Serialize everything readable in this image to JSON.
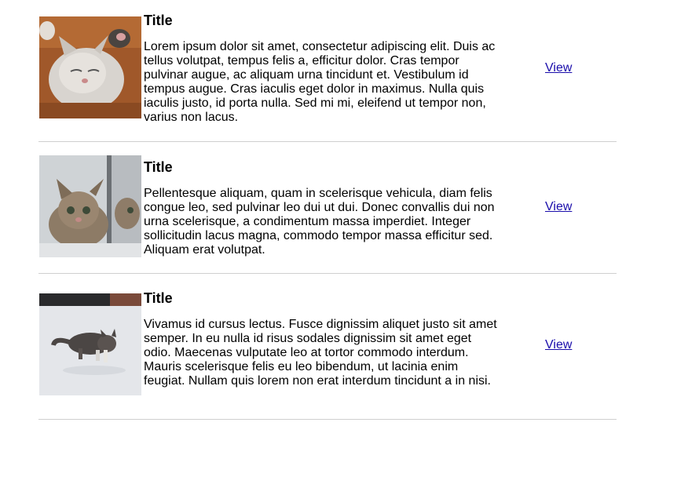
{
  "items": [
    {
      "title": "Title",
      "body": "Lorem ipsum dolor sit amet, consectetur adipiscing elit. Duis ac tellus volutpat, tempus felis a, efficitur dolor. Cras tempor pulvinar augue, ac aliquam urna tincidunt et. Vestibulum id tempus augue. Cras iaculis eget dolor in maximus. Nulla quis iaculis justo, id porta nulla. Sed mi mi, eleifend ut tempor non, varius non lacus.",
      "link": "View"
    },
    {
      "title": "Title",
      "body": "Pellentesque aliquam, quam in scelerisque vehicula, diam felis congue leo, sed pulvinar leo dui ut dui. Donec convallis dui non urna scelerisque, a condimentum massa imperdiet. Integer sollicitudin lacus magna, commodo tempor massa efficitur sed. Aliquam erat volutpat.",
      "link": "View"
    },
    {
      "title": "Title",
      "body": "Vivamus id cursus lectus. Fusce dignissim aliquet justo sit amet semper. In eu nulla id risus sodales dignissim sit amet eget odio. Maecenas vulputate leo at tortor commodo interdum. Mauris scelerisque felis eu leo bibendum, ut lacinia enim feugiat. Nullam quis lorem non erat interdum tincidunt a in nisi.",
      "link": "View"
    }
  ]
}
